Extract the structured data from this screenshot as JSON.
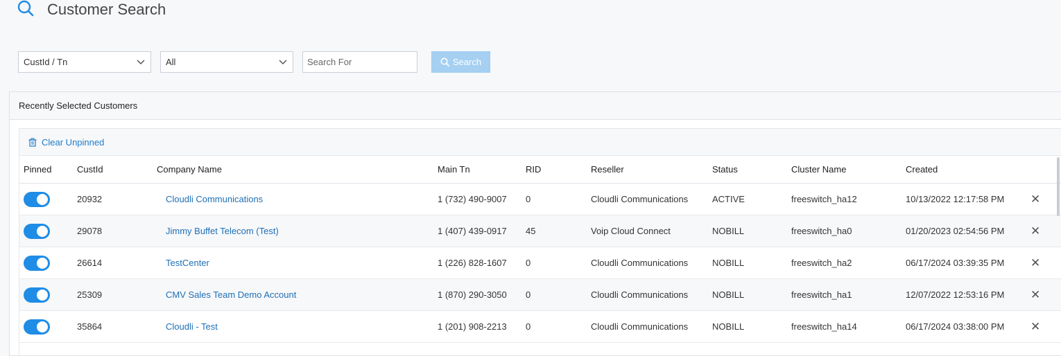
{
  "header": {
    "title": "Customer Search"
  },
  "filters": {
    "field_select": "CustId / Tn",
    "scope_select": "All",
    "search_placeholder": "Search For",
    "search_button": "Search"
  },
  "panel": {
    "title": "Recently Selected Customers",
    "clear_button": "Clear Unpinned"
  },
  "table": {
    "columns": [
      "Pinned",
      "CustId",
      "Company Name",
      "Main Tn",
      "RID",
      "Reseller",
      "Status",
      "Cluster Name",
      "Created"
    ],
    "rows": [
      {
        "pinned": true,
        "custid": "20932",
        "company": "Cloudli Communications",
        "main_tn": "1 (732) 490-9007",
        "rid": "0",
        "reseller": "Cloudli Communications",
        "status": "ACTIVE",
        "cluster": "freeswitch_ha12",
        "created": "10/13/2022 12:17:58 PM"
      },
      {
        "pinned": true,
        "custid": "29078",
        "company": "Jimmy Buffet Telecom (Test)",
        "main_tn": "1 (407) 439-0917",
        "rid": "45",
        "reseller": "Voip Cloud Connect",
        "status": "NOBILL",
        "cluster": "freeswitch_ha0",
        "created": "01/20/2023 02:54:56 PM"
      },
      {
        "pinned": true,
        "custid": "26614",
        "company": "TestCenter",
        "main_tn": "1 (226) 828-1607",
        "rid": "0",
        "reseller": "Cloudli Communications",
        "status": "NOBILL",
        "cluster": "freeswitch_ha2",
        "created": "06/17/2024 03:39:35 PM"
      },
      {
        "pinned": true,
        "custid": "25309",
        "company": "CMV Sales Team Demo Account",
        "main_tn": "1 (870) 290-3050",
        "rid": "0",
        "reseller": "Cloudli Communications",
        "status": "NOBILL",
        "cluster": "freeswitch_ha1",
        "created": "12/07/2022 12:53:16 PM"
      },
      {
        "pinned": true,
        "custid": "35864",
        "company": "Cloudli - Test",
        "main_tn": "1 (201) 908-2213",
        "rid": "0",
        "reseller": "Cloudli Communications",
        "status": "NOBILL",
        "cluster": "freeswitch_ha14",
        "created": "06/17/2024 03:38:00 PM"
      }
    ],
    "remove_glyph": "✕"
  },
  "colors": {
    "accent": "#1f8ce6",
    "link": "#1e6fb5",
    "search_button_disabled": "#a6d0f1"
  }
}
